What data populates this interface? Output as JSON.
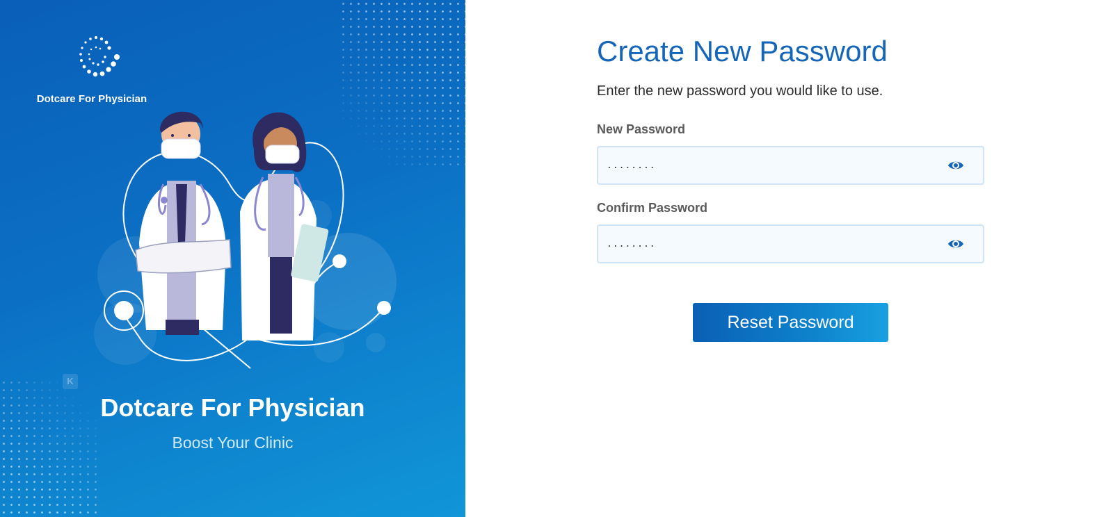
{
  "brand": {
    "logo_icon": "dotted-ring-logo",
    "small_name": "Dotcare For Physician",
    "title": "Dotcare For Physician",
    "tagline": "Boost Your Clinic"
  },
  "form": {
    "title": "Create New Password",
    "description": "Enter the new password you would like to use.",
    "new_password": {
      "label": "New Password",
      "value": "........",
      "toggle_icon": "eye-icon"
    },
    "confirm_password": {
      "label": "Confirm Password",
      "value": "........",
      "toggle_icon": "eye-icon"
    },
    "submit_label": "Reset Password"
  },
  "colors": {
    "panel_start": "#0a5fb8",
    "panel_end": "#1196d8",
    "title_blue": "#1565b8",
    "field_bg": "#f5faff",
    "field_border": "#cfe3f7"
  }
}
